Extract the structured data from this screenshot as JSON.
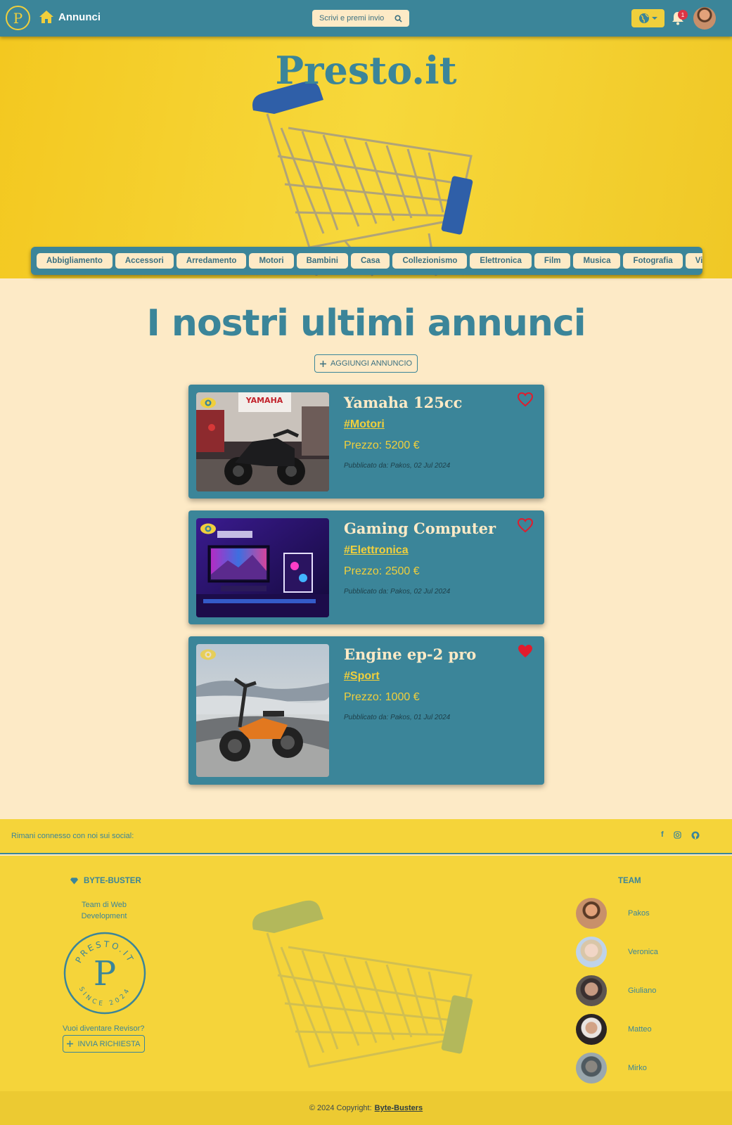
{
  "nav": {
    "logo_letter": "P",
    "home_label": "Annunci",
    "search_placeholder": "Scrivi e premi invio",
    "notification_count": "1"
  },
  "hero": {
    "title": "Presto.it"
  },
  "categories": [
    "Abbigliamento",
    "Accessori",
    "Arredamento",
    "Motori",
    "Bambini",
    "Casa",
    "Collezionismo",
    "Elettronica",
    "Film",
    "Musica",
    "Fotografia",
    "Videogioc"
  ],
  "main": {
    "title": "I nostri ultimi annunci",
    "add_button": "AGGIUNGI ANNUNCIO"
  },
  "listings": [
    {
      "title": "Yamaha 125cc",
      "category": "#Motori",
      "price": "Prezzo: 5200 €",
      "published": "Pubblicato da: Pakos, 02 Jul 2024",
      "favorite": false,
      "image": "motorbike"
    },
    {
      "title": "Gaming Computer",
      "category": "#Elettronica",
      "price": "Prezzo: 2500 €",
      "published": "Pubblicato da: Pakos, 02 Jul 2024",
      "favorite": false,
      "image": "gaming-pc"
    },
    {
      "title": "Engine ep-2 pro",
      "category": "#Sport",
      "price": "Prezzo: 1000 €",
      "published": "Pubblicato da: Pakos, 01 Jul 2024",
      "favorite": true,
      "image": "e-bike"
    }
  ],
  "footer": {
    "social_text": "Rimani connesso con noi sui social:",
    "social_icons": [
      "facebook-icon",
      "instagram-icon",
      "github-icon"
    ],
    "brand_name": "BYTE-BUSTER",
    "brand_subtitle": "Team di Web Development",
    "stamp": {
      "top": "PRESTO.IT",
      "bottom": "SINCE 2024",
      "letter": "P"
    },
    "revisor_question": "Vuoi diventare Revisor?",
    "revisor_button": "INVIA RICHIESTA",
    "team_heading": "TEAM",
    "team": [
      "Pakos",
      "Veronica",
      "Giuliano",
      "Matteo",
      "Mirko"
    ],
    "copyright": "© 2024 Copyright:",
    "copyright_link": "Byte-Busters"
  },
  "colors": {
    "primary": "#3b8599",
    "accent": "#f0cf3c",
    "background": "#fdeac6",
    "favorite": "#e21b2c"
  }
}
